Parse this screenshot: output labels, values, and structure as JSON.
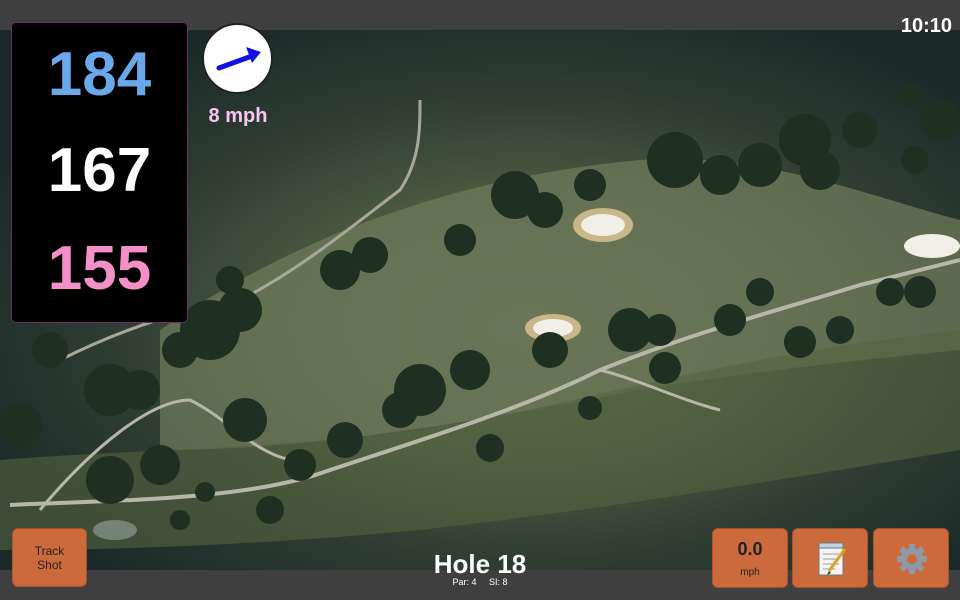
{
  "status": {
    "time": "10:10"
  },
  "distances": {
    "back": "184",
    "middle": "167",
    "front": "155"
  },
  "wind": {
    "speed": "8 mph",
    "icon": "wind-arrow-icon"
  },
  "buttons": {
    "track_shot": {
      "line1": "Track",
      "line2": "Shot"
    },
    "speed": {
      "value": "0.0",
      "unit": "mph"
    },
    "notes": {
      "icon": "notepad-icon"
    },
    "settings": {
      "icon": "gear-icon"
    }
  },
  "hole": {
    "title": "Hole 18",
    "par": "Par: 4",
    "si": "SI: 8"
  },
  "colors": {
    "back_distance": "#6aa8ec",
    "middle_distance": "#ffffff",
    "front_distance": "#f58fc7",
    "wind_text": "#f7c6ef",
    "button": "#cc6a3c",
    "bar": "#3f3f3f"
  }
}
